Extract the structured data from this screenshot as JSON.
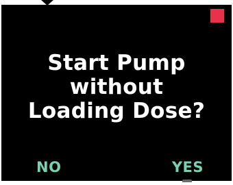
{
  "screen": {
    "prompt_lines": [
      "Start Pump",
      "without",
      "Loading Dose?"
    ]
  },
  "softkeys": {
    "left_label": "NO",
    "right_label": "YES"
  },
  "colors": {
    "background": "#000000",
    "text": "#ffffff",
    "softkey": "#7bcfb3",
    "status_indicator": "#e8314a"
  },
  "icons": {
    "status_indicator": "red-square-icon",
    "top_tab": "down-triangle-icon"
  }
}
